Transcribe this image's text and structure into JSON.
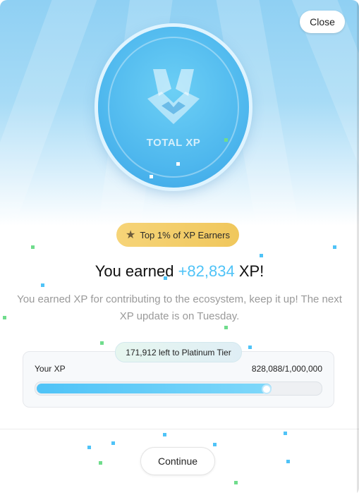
{
  "header": {
    "close_label": "Close"
  },
  "coin": {
    "label": "TOTAL XP"
  },
  "badge": {
    "text": "Top 1% of XP Earners"
  },
  "headline": {
    "prefix": "You earned",
    "amount": "+82,834",
    "suffix": "XP!"
  },
  "description": "You earned XP for contributing to the ecosystem, keep it up! The next XP update is on Tuesday.",
  "progress": {
    "pill_text": "171,912 left to Platinum Tier",
    "label": "Your XP",
    "value_text": "828,088/1,000,000",
    "fraction": 0.828
  },
  "footer": {
    "continue_label": "Continue"
  },
  "colors": {
    "accent": "#4fc3f7",
    "gold": "#f0c75c"
  }
}
